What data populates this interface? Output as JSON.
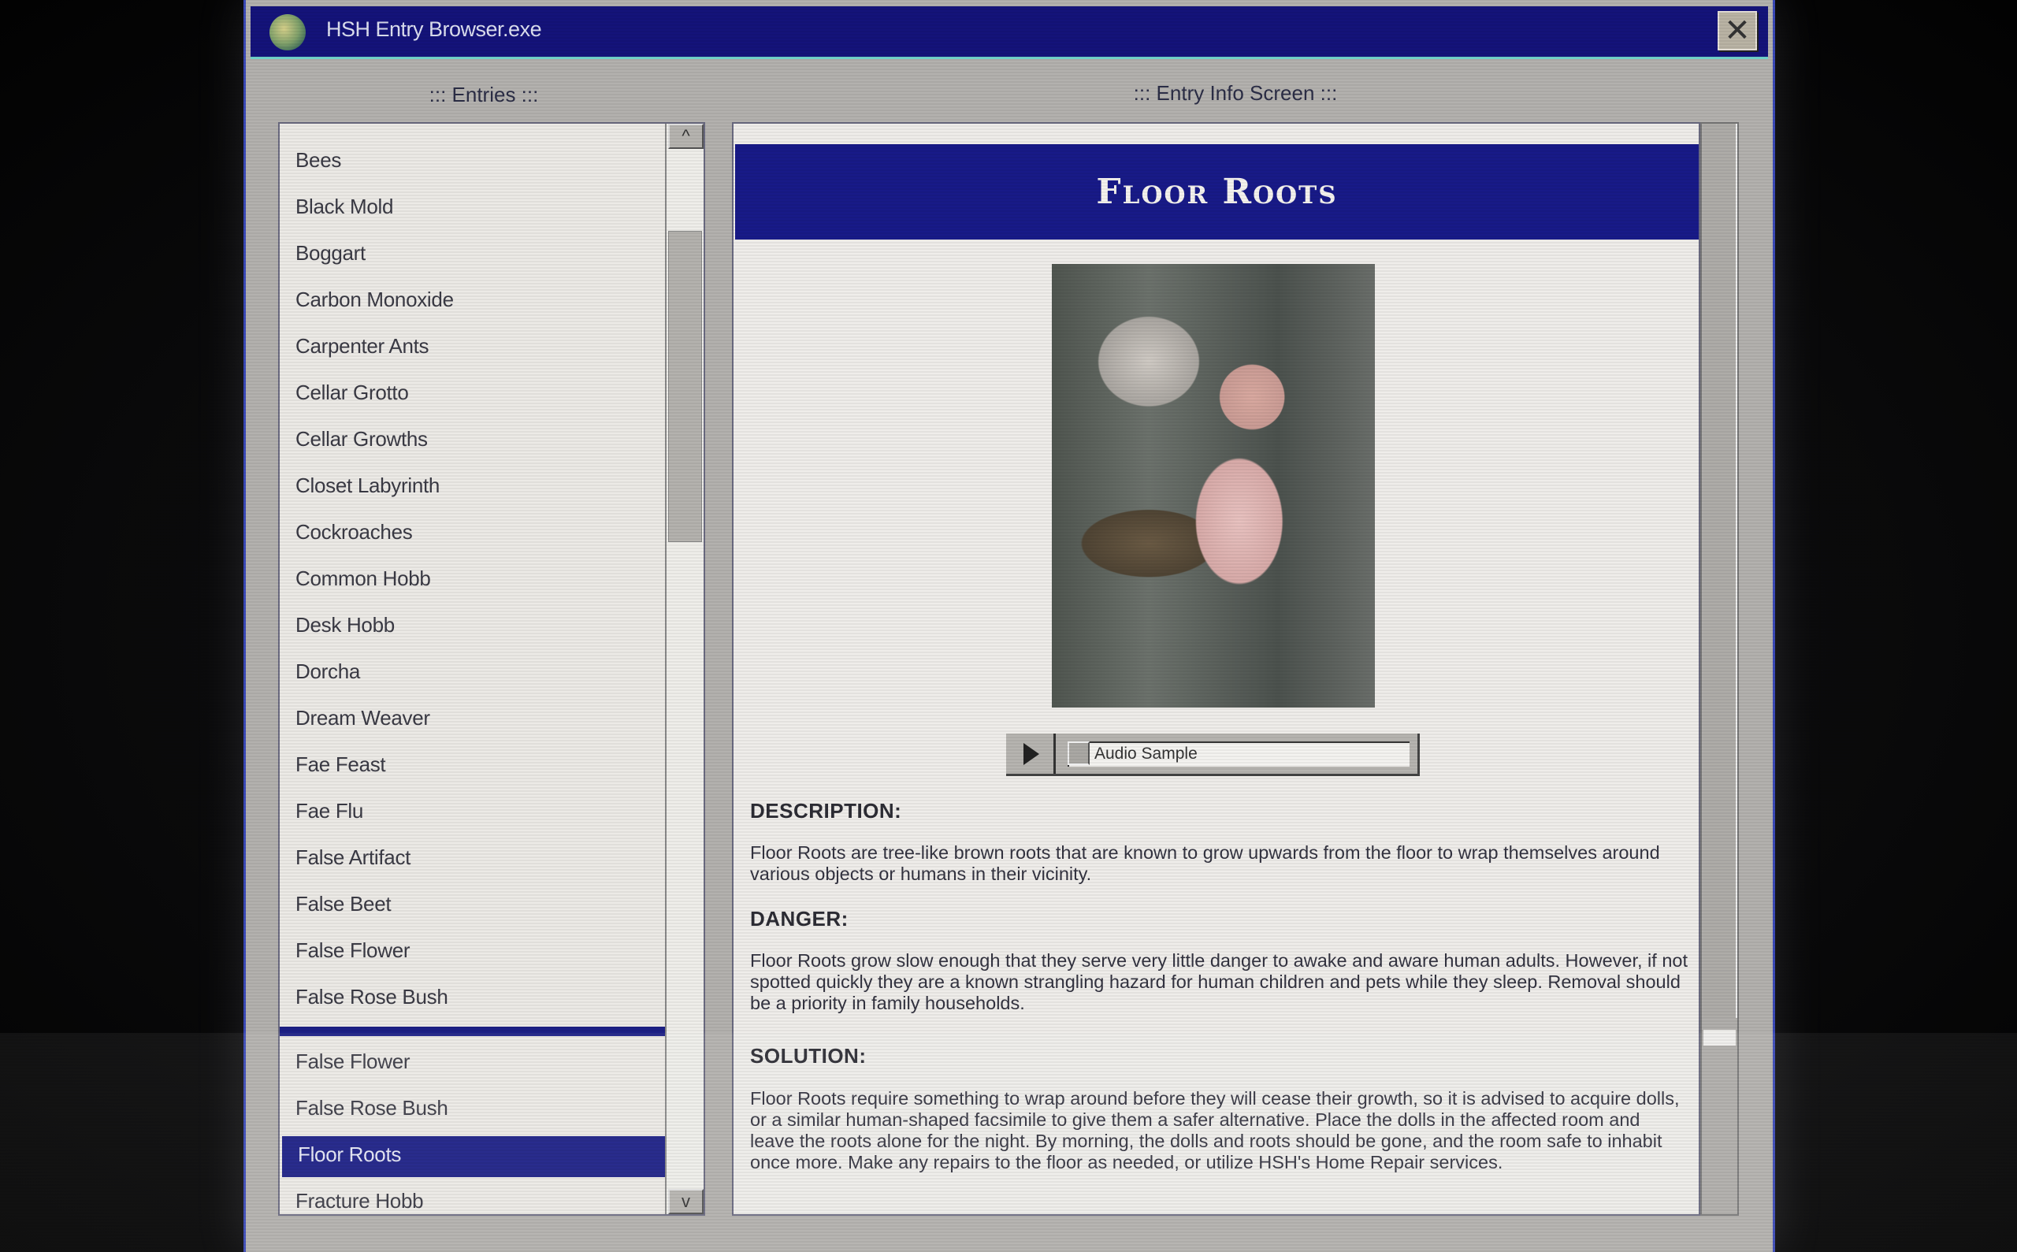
{
  "window": {
    "title": "HSH Entry Browser.exe",
    "close_icon": "close-x-icon"
  },
  "entries": {
    "label": "::: Entries :::",
    "items": [
      "Bees",
      "Black Mold",
      "Boggart",
      "Carbon Monoxide",
      "Carpenter Ants",
      "Cellar Grotto",
      "Cellar Growths",
      "Closet Labyrinth",
      "Cockroaches",
      "Common Hobb",
      "Desk Hobb",
      "Dorcha",
      "Dream Weaver",
      "Fae Feast",
      "Fae Flu",
      "False Artifact",
      "False Beet",
      "False Flower",
      "False Rose Bush"
    ],
    "lower_items": [
      "False Flower",
      "False Rose Bush",
      "Floor Roots",
      "Fracture Hobb"
    ],
    "selected": "Floor Roots",
    "scroll_up": "^",
    "scroll_down": "v"
  },
  "info": {
    "label": "::: Entry Info Screen :::",
    "title": "Floor Roots",
    "audio_label": "Audio Sample",
    "sections": [
      {
        "heading": "DESCRIPTION:",
        "text": "Floor Roots are tree-like brown roots that are known to grow upwards from the floor to wrap themselves around various objects or humans in their vicinity."
      },
      {
        "heading": "DANGER:",
        "text": "Floor Roots grow slow enough that they serve very little danger to awake and aware human adults. However, if not spotted quickly they are a known strangling hazard for human children and pets while they sleep. Removal should be a priority in family households."
      },
      {
        "heading": "SOLUTION:",
        "text": "Floor Roots require something to wrap around before they will cease their growth, so it is advised to acquire dolls, or a similar human-shaped facsimile to give them a safer alternative. Place the dolls in the affected room and leave the roots alone for the night. By morning, the dolls and roots should be gone, and the room safe to inhabit once more. Make any repairs to the floor as needed, or utilize HSH's Home Repair services."
      }
    ]
  },
  "colors": {
    "titlebar": "#14137a",
    "selection": "#1c1f86",
    "window": "#b3b1ae"
  }
}
